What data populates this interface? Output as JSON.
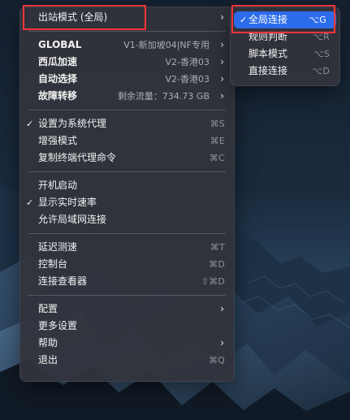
{
  "main_menu": {
    "items": [
      {
        "label": "出站模式 (全局)",
        "submenu": true
      },
      {
        "label": "GLOBAL",
        "value": "V1-新加坡04|NF专用",
        "submenu": true
      },
      {
        "label": "西瓜加速",
        "value": "V2-香港03",
        "submenu": true
      },
      {
        "label": "自动选择",
        "value": "V2-香港03",
        "submenu": true
      },
      {
        "label": "故障转移",
        "value": "剩余流量：734.73 GB",
        "submenu": true
      },
      {
        "label": "设置为系统代理",
        "checked": true,
        "shortcut": "⌘S"
      },
      {
        "label": "增强模式",
        "shortcut": "⌘E"
      },
      {
        "label": "复制终端代理命令",
        "shortcut": "⌘C"
      },
      {
        "label": "开机启动"
      },
      {
        "label": "显示实时速率",
        "checked": true
      },
      {
        "label": "允许局域网连接"
      },
      {
        "label": "延迟测速",
        "shortcut": "⌘T"
      },
      {
        "label": "控制台",
        "shortcut": "⌘D"
      },
      {
        "label": "连接查看器",
        "shortcut": "⇧⌘D"
      },
      {
        "label": "配置",
        "submenu": true
      },
      {
        "label": "更多设置"
      },
      {
        "label": "帮助",
        "submenu": true
      },
      {
        "label": "退出",
        "shortcut": "⌘Q"
      }
    ]
  },
  "submenu": {
    "items": [
      {
        "label": "全局连接",
        "checked": true,
        "shortcut": "⌥G",
        "active": true
      },
      {
        "label": "规则判断",
        "shortcut": "⌥R"
      },
      {
        "label": "脚本模式",
        "shortcut": "⌥S"
      },
      {
        "label": "直接连接",
        "shortcut": "⌥D"
      }
    ]
  },
  "icons": {
    "check": "check-icon",
    "submenu_arrow": "chevron-right-icon"
  },
  "colors": {
    "menu_background": "#31343c",
    "highlight_blue": "#2c6cea",
    "annotation_red": "#ff3437",
    "secondary_text": "#a8adb6",
    "shortcut_text": "#8d9199"
  }
}
